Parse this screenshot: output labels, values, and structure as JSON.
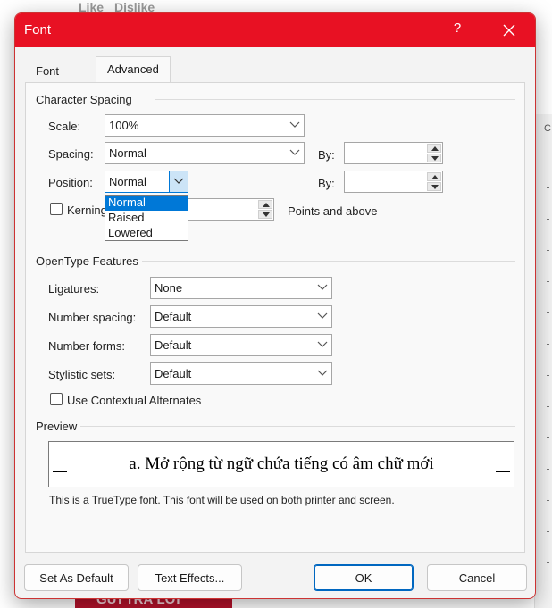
{
  "background": {
    "like": "Like",
    "dislike": "Dislike",
    "bottom_button": "GỬI TRẢ LỜI",
    "ruler_label": "C"
  },
  "dialog": {
    "title": "Font",
    "help": "?",
    "tabs": [
      {
        "label": "Font"
      },
      {
        "label": "Advanced"
      }
    ],
    "character_spacing": {
      "heading": "Character Spacing",
      "scale_label": "Scale:",
      "scale_value": "100%",
      "spacing_label": "Spacing:",
      "spacing_value": "Normal",
      "spacing_by_label": "By:",
      "spacing_by_value": "",
      "position_label": "Position:",
      "position_value": "Normal",
      "position_by_label": "By:",
      "position_by_value": "",
      "position_options": [
        "Normal",
        "Raised",
        "Lowered"
      ],
      "kerning_label": "Kerning",
      "kerning_checked": false,
      "kerning_points_value": "",
      "points_label": "Points and above"
    },
    "opentype": {
      "heading": "OpenType Features",
      "ligatures_label": "Ligatures:",
      "ligatures_value": "None",
      "number_spacing_label": "Number spacing:",
      "number_spacing_value": "Default",
      "number_forms_label": "Number forms:",
      "number_forms_value": "Default",
      "stylistic_sets_label": "Stylistic sets:",
      "stylistic_sets_value": "Default",
      "contextual_label": "Use Contextual Alternates",
      "contextual_checked": false
    },
    "preview": {
      "heading": "Preview",
      "text": "a. Mở rộng từ ngữ chứa tiếng có âm chữ mới",
      "note": "This is a TrueType font. This font will be used on both printer and screen."
    },
    "buttons": {
      "set_default": "Set As Default",
      "text_effects": "Text Effects...",
      "ok": "OK",
      "cancel": "Cancel"
    },
    "colors": {
      "titlebar": "#e81123",
      "selection": "#0078d7"
    }
  }
}
